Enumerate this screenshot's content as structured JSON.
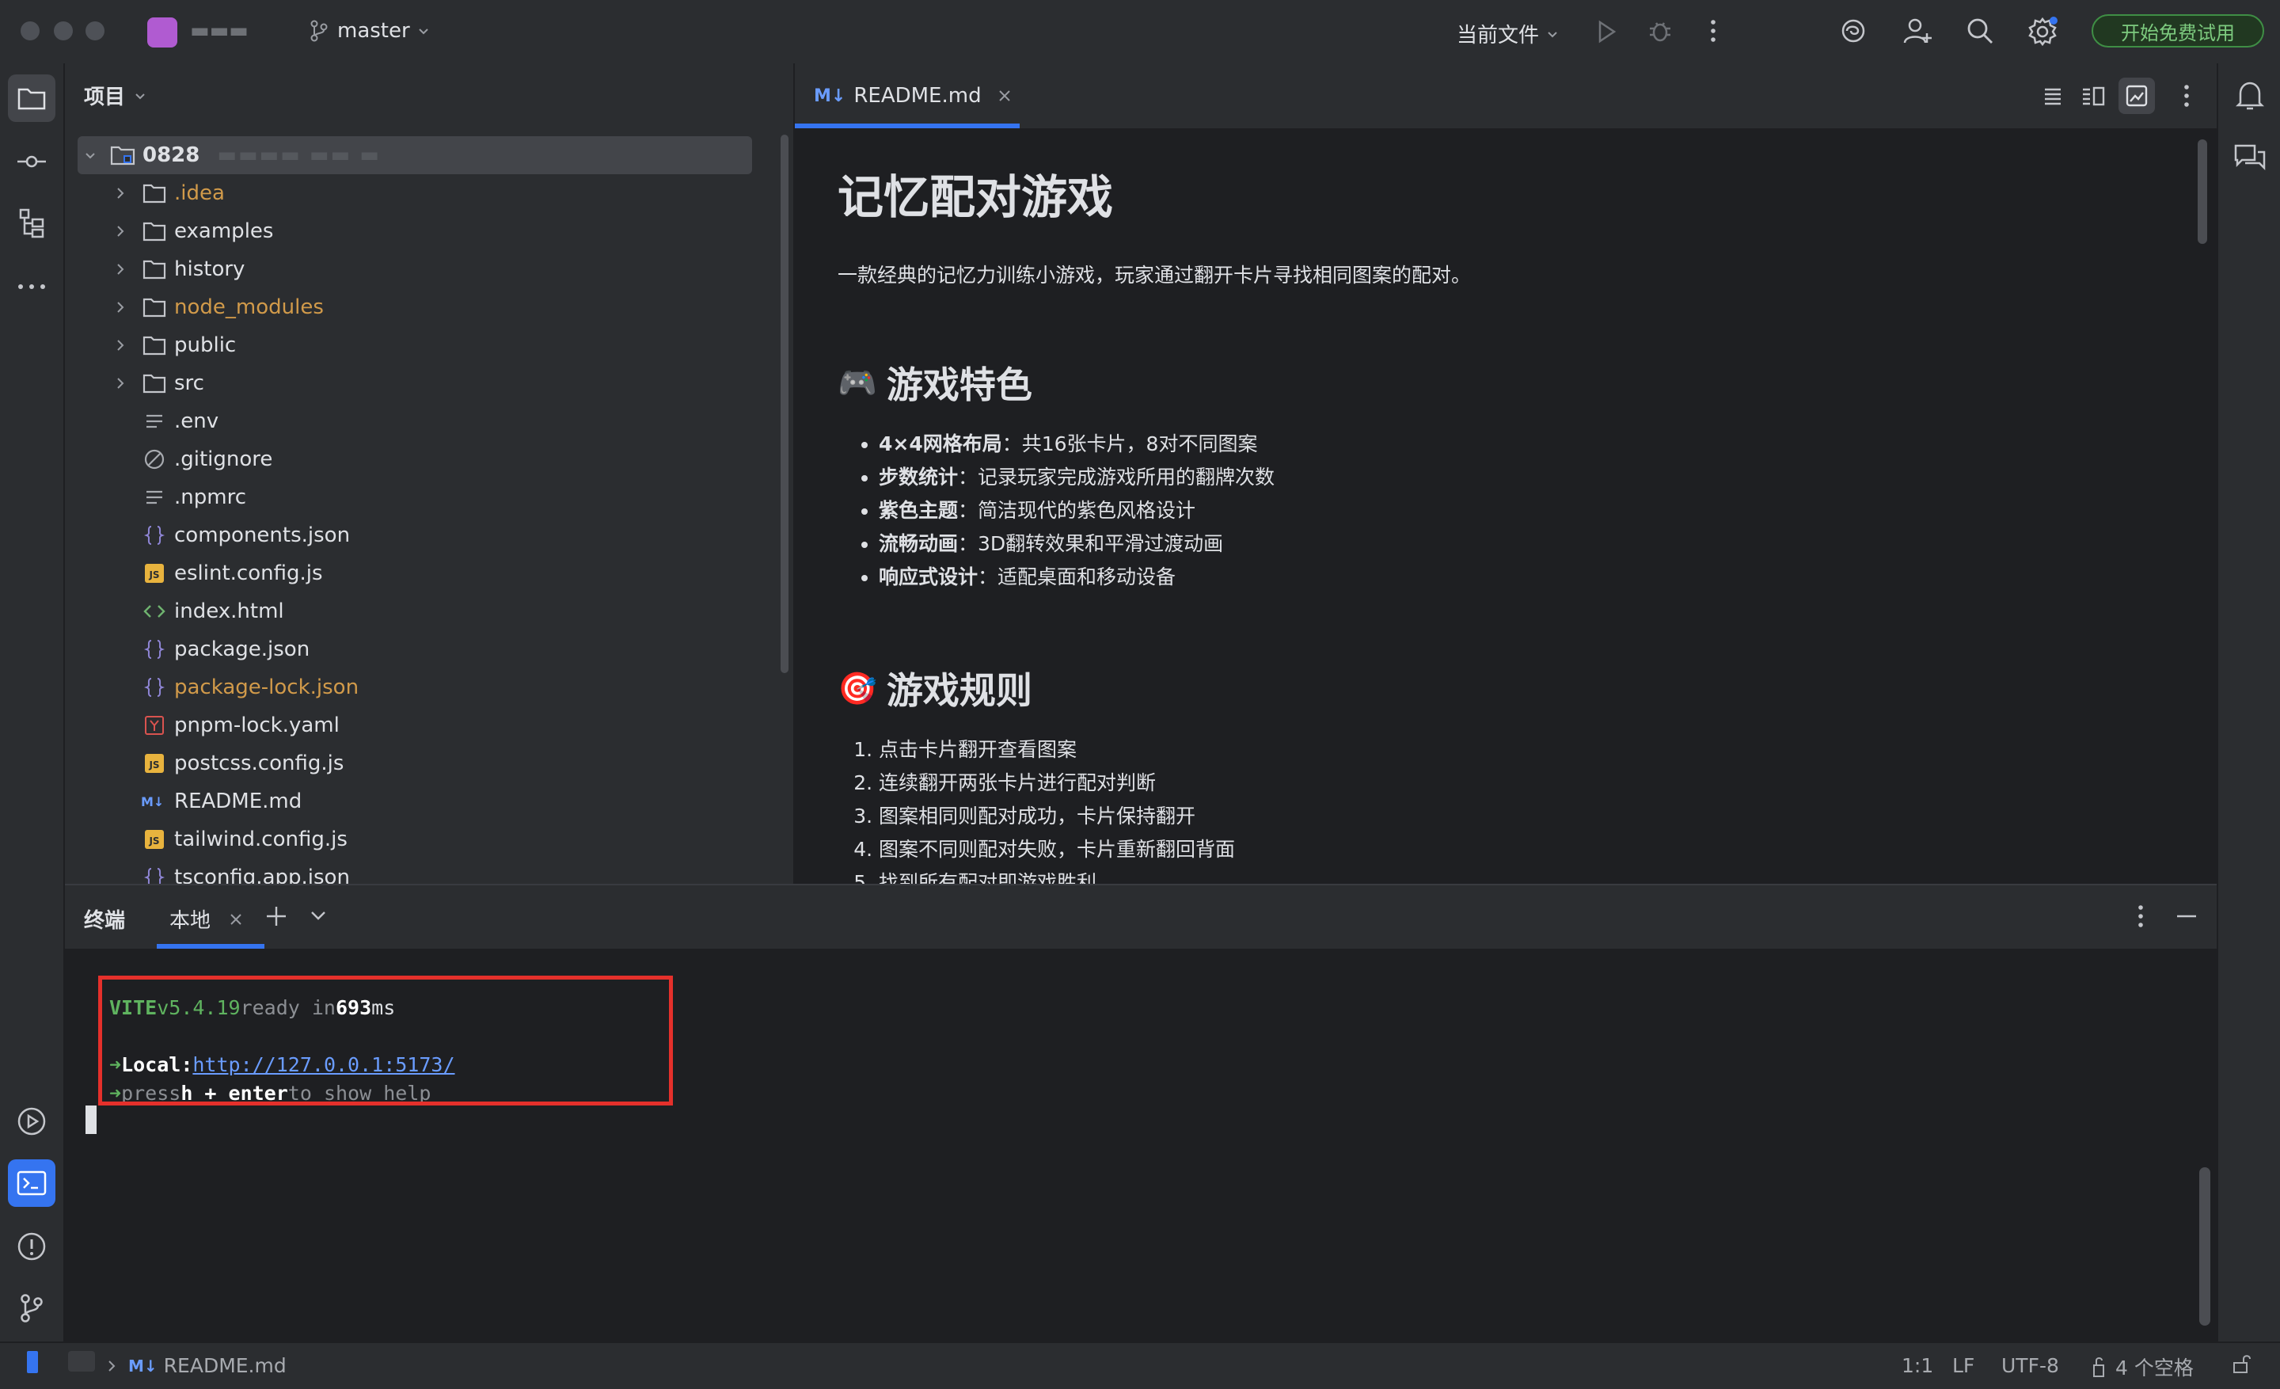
{
  "titlebar": {
    "project_name": "▬▬▬",
    "branch": "master",
    "run_config": "当前文件",
    "trial_button": "开始免费试用"
  },
  "project_panel": {
    "title": "项目",
    "root": {
      "name": "0828",
      "path_blurred": "▬▬▬▬ ▬▬ ▬"
    },
    "items": [
      {
        "name": ".idea",
        "type": "folder",
        "status": "ignored"
      },
      {
        "name": "examples",
        "type": "folder",
        "status": "normal"
      },
      {
        "name": "history",
        "type": "folder",
        "status": "normal"
      },
      {
        "name": "node_modules",
        "type": "folder",
        "status": "ignored"
      },
      {
        "name": "public",
        "type": "folder",
        "status": "normal"
      },
      {
        "name": "src",
        "type": "folder",
        "status": "normal"
      },
      {
        "name": ".env",
        "type": "text",
        "status": "normal"
      },
      {
        "name": ".gitignore",
        "type": "ignore",
        "status": "normal"
      },
      {
        "name": ".npmrc",
        "type": "text",
        "status": "normal"
      },
      {
        "name": "components.json",
        "type": "json",
        "status": "normal"
      },
      {
        "name": "eslint.config.js",
        "type": "js",
        "status": "normal"
      },
      {
        "name": "index.html",
        "type": "html",
        "status": "normal"
      },
      {
        "name": "package.json",
        "type": "json",
        "status": "normal"
      },
      {
        "name": "package-lock.json",
        "type": "json",
        "status": "ignored"
      },
      {
        "name": "pnpm-lock.yaml",
        "type": "yaml",
        "status": "normal"
      },
      {
        "name": "postcss.config.js",
        "type": "js",
        "status": "normal"
      },
      {
        "name": "README.md",
        "type": "md",
        "status": "normal"
      },
      {
        "name": "tailwind.config.js",
        "type": "js",
        "status": "normal"
      },
      {
        "name": "tsconfig.app.json",
        "type": "json",
        "status": "normal"
      }
    ]
  },
  "editor": {
    "tab_label": "README.md",
    "tab_badge": "M↓",
    "content": {
      "h1": "记忆配对游戏",
      "intro": "一款经典的记忆力训练小游戏，玩家通过翻开卡片寻找相同图案的配对。",
      "features_title": "游戏特色",
      "features_emoji": "🎮",
      "features": [
        {
          "bold": "4×4网格布局",
          "text": "：共16张卡片，8对不同图案"
        },
        {
          "bold": "步数统计",
          "text": "：记录玩家完成游戏所用的翻牌次数"
        },
        {
          "bold": "紫色主题",
          "text": "：简洁现代的紫色风格设计"
        },
        {
          "bold": "流畅动画",
          "text": "：3D翻转效果和平滑过渡动画"
        },
        {
          "bold": "响应式设计",
          "text": "：适配桌面和移动设备"
        }
      ],
      "rules_title": "游戏规则",
      "rules_emoji": "🎯",
      "rules": [
        "点击卡片翻开查看图案",
        "连续翻开两张卡片进行配对判断",
        "图案相同则配对成功，卡片保持翻开",
        "图案不同则配对失败，卡片重新翻回背面",
        "找到所有配对即游戏胜利"
      ]
    }
  },
  "terminal": {
    "title": "终端",
    "tab_label": "本地",
    "lines": {
      "vite": "VITE",
      "version": "v5.4.19",
      "ready": "ready in",
      "ms_value": "693",
      "ms_unit": "ms",
      "arrow": "➜",
      "local_label": "Local:",
      "local_url": "http://127.0.0.1:5173/",
      "press": "press",
      "keys": "h + enter",
      "to_show_help": "to show help"
    }
  },
  "statusbar": {
    "breadcrumb_badge": "M↓",
    "breadcrumb_file": "README.md",
    "position": "1:1",
    "line_ending": "LF",
    "encoding": "UTF-8",
    "indent": "4 个空格"
  },
  "colors": {
    "accent": "#3574f0",
    "highlight_box": "#e5302b",
    "vite_green": "#5fb35f",
    "link": "#6a9cff",
    "ignored": "#d19a4a"
  }
}
